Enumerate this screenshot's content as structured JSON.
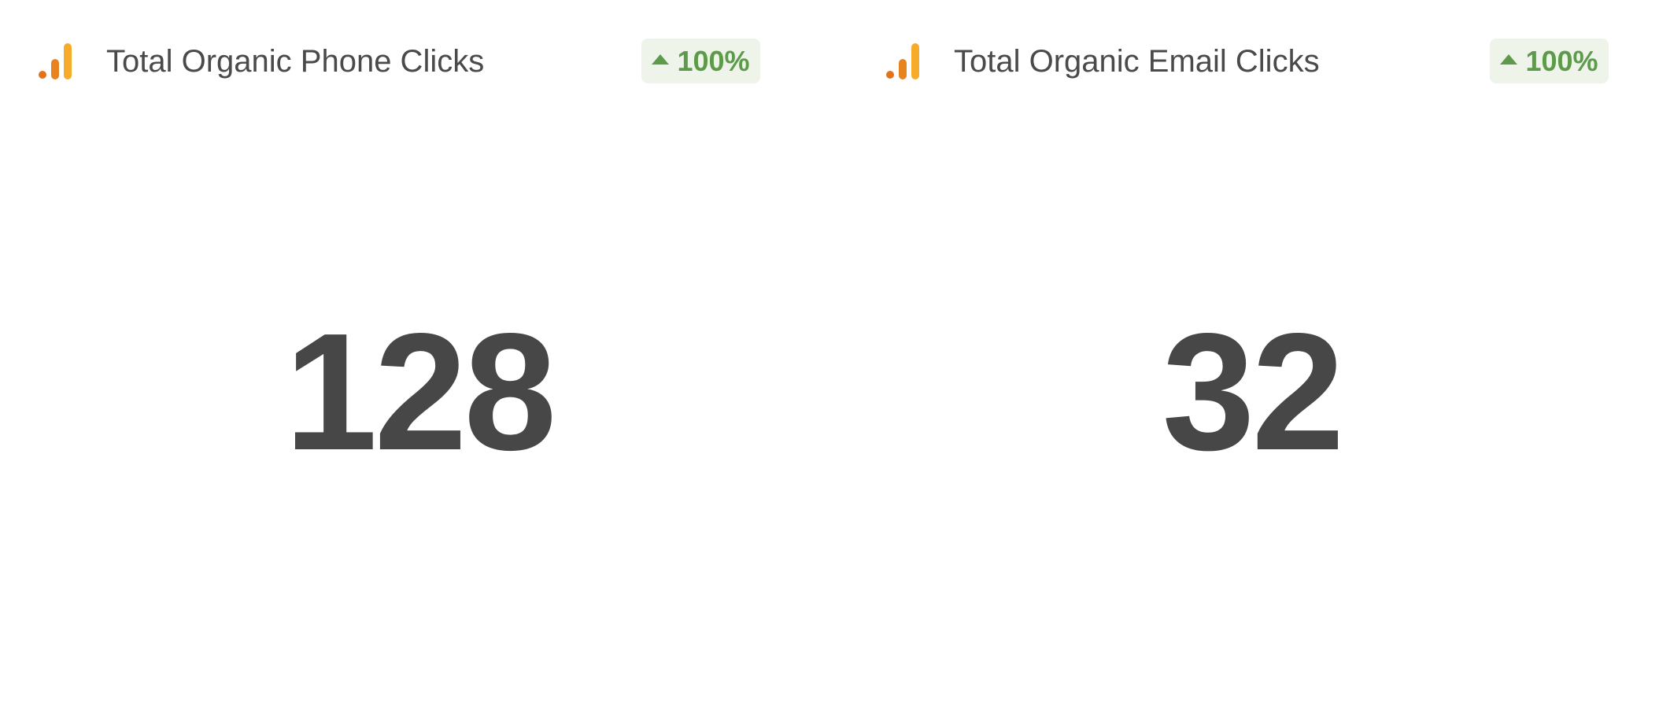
{
  "cards": [
    {
      "title": "Total Organic Phone Clicks",
      "change": "100%",
      "change_direction": "up",
      "value": "128",
      "icon": "google-analytics-icon"
    },
    {
      "title": "Total Organic Email Clicks",
      "change": "100%",
      "change_direction": "up",
      "value": "32",
      "icon": "google-analytics-icon"
    }
  ],
  "colors": {
    "badge_bg": "#eef4ea",
    "badge_text": "#5d9b4a",
    "value_text": "#474747",
    "title_text": "#4a4a4a",
    "icon_dark": "#e2731b",
    "icon_light": "#f6ab2a"
  }
}
